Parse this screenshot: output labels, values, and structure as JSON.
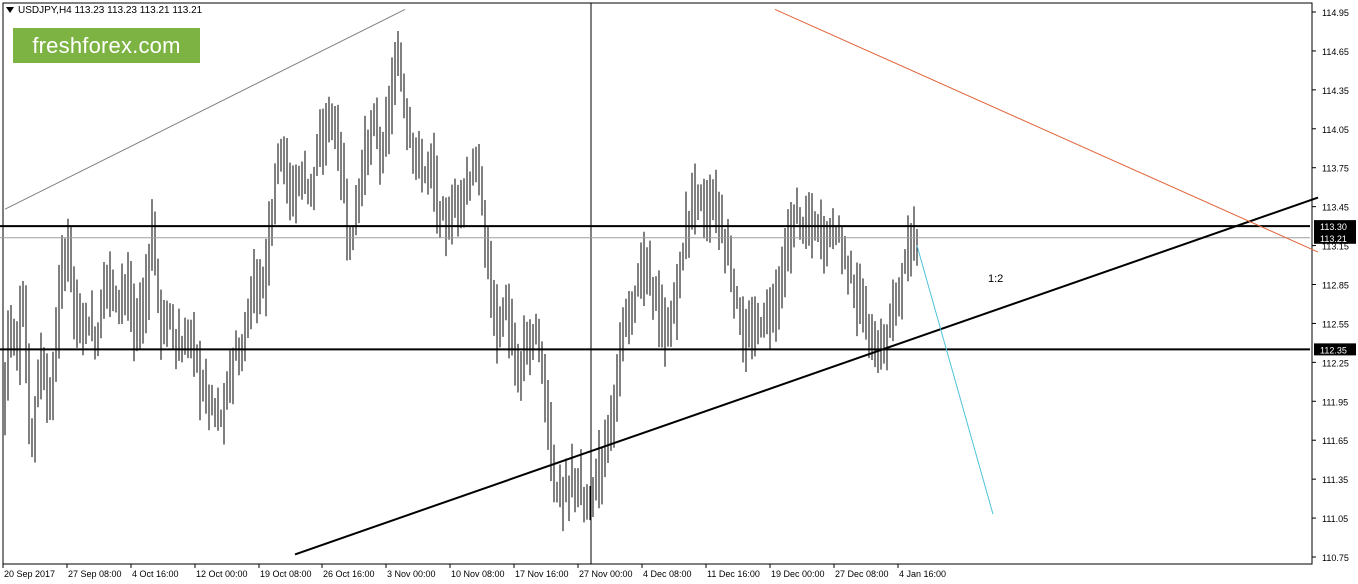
{
  "header": {
    "symbol_line": "USDJPY,H4  113.23 113.23 113.21 113.21"
  },
  "logo": {
    "text": "freshforex.com"
  },
  "chart_data": {
    "type": "candlestick",
    "symbol": "USDJPY",
    "timeframe": "H4",
    "ylim": [
      10.75,
      114.95
    ],
    "y_ticks": [
      "114.95",
      "114.65",
      "114.35",
      "114.05",
      "113.75",
      "113.45",
      "113.15",
      "112.85",
      "112.55",
      "112.25",
      "111.95",
      "111.65",
      "111.35",
      "111.05",
      "110.75"
    ],
    "x_ticks": [
      "20 Sep 2017",
      "27 Sep 08:00",
      "4 Oct 16:00",
      "12 Oct 00:00",
      "19 Oct 08:00",
      "26 Oct 16:00",
      "3 Nov 00:00",
      "10 Nov 08:00",
      "17 Nov 16:00",
      "27 Nov 00:00",
      "4 Dec 08:00",
      "11 Dec 16:00",
      "19 Dec 00:00",
      "27 Dec 08:00",
      "4 Jan 16:00"
    ],
    "price_tags": [
      {
        "label": "113.30",
        "value": 113.3,
        "style": "level"
      },
      {
        "label": "113.21",
        "value": 113.21,
        "style": "current"
      },
      {
        "label": "112.35",
        "value": 112.35,
        "style": "level"
      }
    ],
    "annotation": {
      "text": "1:2"
    },
    "key_path": [
      [
        0,
        111.5
      ],
      [
        8,
        112.6
      ],
      [
        16,
        112.3
      ],
      [
        22,
        112.8
      ],
      [
        30,
        111.6
      ],
      [
        40,
        112.3
      ],
      [
        50,
        111.9
      ],
      [
        60,
        112.9
      ],
      [
        68,
        113.2
      ],
      [
        76,
        112.5
      ],
      [
        86,
        112.6
      ],
      [
        96,
        112.4
      ],
      [
        106,
        113.0
      ],
      [
        114,
        112.7
      ],
      [
        124,
        112.9
      ],
      [
        134,
        112.5
      ],
      [
        144,
        112.7
      ],
      [
        152,
        113.3
      ],
      [
        160,
        112.5
      ],
      [
        170,
        112.6
      ],
      [
        180,
        112.3
      ],
      [
        190,
        112.5
      ],
      [
        200,
        112.1
      ],
      [
        212,
        111.9
      ],
      [
        222,
        111.8
      ],
      [
        232,
        112.3
      ],
      [
        242,
        112.3
      ],
      [
        252,
        112.9
      ],
      [
        262,
        112.8
      ],
      [
        272,
        113.5
      ],
      [
        280,
        114.0
      ],
      [
        290,
        113.5
      ],
      [
        300,
        113.7
      ],
      [
        310,
        113.6
      ],
      [
        320,
        113.9
      ],
      [
        330,
        114.2
      ],
      [
        340,
        113.8
      ],
      [
        350,
        113.1
      ],
      [
        358,
        113.6
      ],
      [
        366,
        113.9
      ],
      [
        374,
        114.1
      ],
      [
        382,
        113.8
      ],
      [
        390,
        114.3
      ],
      [
        398,
        114.6
      ],
      [
        406,
        114.1
      ],
      [
        414,
        113.9
      ],
      [
        422,
        113.7
      ],
      [
        430,
        113.8
      ],
      [
        438,
        113.4
      ],
      [
        446,
        113.3
      ],
      [
        456,
        113.5
      ],
      [
        466,
        113.6
      ],
      [
        476,
        113.8
      ],
      [
        486,
        113.1
      ],
      [
        496,
        112.5
      ],
      [
        506,
        112.7
      ],
      [
        516,
        112.1
      ],
      [
        526,
        112.4
      ],
      [
        536,
        112.5
      ],
      [
        546,
        111.9
      ],
      [
        554,
        111.3
      ],
      [
        564,
        111.2
      ],
      [
        574,
        111.4
      ],
      [
        584,
        111.1
      ],
      [
        594,
        111.3
      ],
      [
        604,
        111.6
      ],
      [
        614,
        112.0
      ],
      [
        624,
        112.5
      ],
      [
        634,
        112.8
      ],
      [
        644,
        113.0
      ],
      [
        654,
        112.8
      ],
      [
        664,
        112.4
      ],
      [
        674,
        112.7
      ],
      [
        684,
        113.2
      ],
      [
        694,
        113.6
      ],
      [
        704,
        113.4
      ],
      [
        714,
        113.5
      ],
      [
        724,
        113.2
      ],
      [
        734,
        112.8
      ],
      [
        744,
        112.4
      ],
      [
        754,
        112.5
      ],
      [
        764,
        112.6
      ],
      [
        774,
        112.7
      ],
      [
        784,
        113.0
      ],
      [
        794,
        113.4
      ],
      [
        804,
        113.3
      ],
      [
        814,
        113.3
      ],
      [
        824,
        113.2
      ],
      [
        834,
        113.3
      ],
      [
        844,
        113.1
      ],
      [
        854,
        112.8
      ],
      [
        864,
        112.6
      ],
      [
        874,
        112.3
      ],
      [
        884,
        112.4
      ],
      [
        894,
        112.7
      ],
      [
        904,
        113.0
      ],
      [
        914,
        113.2
      ],
      [
        918,
        113.21
      ]
    ],
    "lines": [
      {
        "name": "upper horizontal",
        "from": [
          0,
          113.3
        ],
        "to": [
          1310,
          113.3
        ],
        "color": "#000000"
      },
      {
        "name": "current price",
        "from": [
          0,
          113.21
        ],
        "to": [
          1310,
          113.21
        ],
        "color": "#9e9e9e"
      },
      {
        "name": "lower horizontal",
        "from": [
          0,
          112.35
        ],
        "to": [
          1310,
          112.35
        ],
        "color": "#000000"
      },
      {
        "name": "rising trendline",
        "from": [
          295,
          110.77
        ],
        "to": [
          1318,
          113.52
        ],
        "color": "#000000"
      },
      {
        "name": "thin grey trend",
        "from": [
          5,
          113.43
        ],
        "to": [
          405,
          114.97
        ],
        "color": "#808080"
      },
      {
        "name": "red trend",
        "from": [
          775,
          114.97
        ],
        "to": [
          1318,
          113.1
        ],
        "color": "#e0663b"
      },
      {
        "name": "projection",
        "from": [
          917,
          113.15
        ],
        "to": [
          993,
          111.08
        ],
        "color": "#4fc3d9"
      }
    ],
    "vertical_marker_x": 591
  }
}
